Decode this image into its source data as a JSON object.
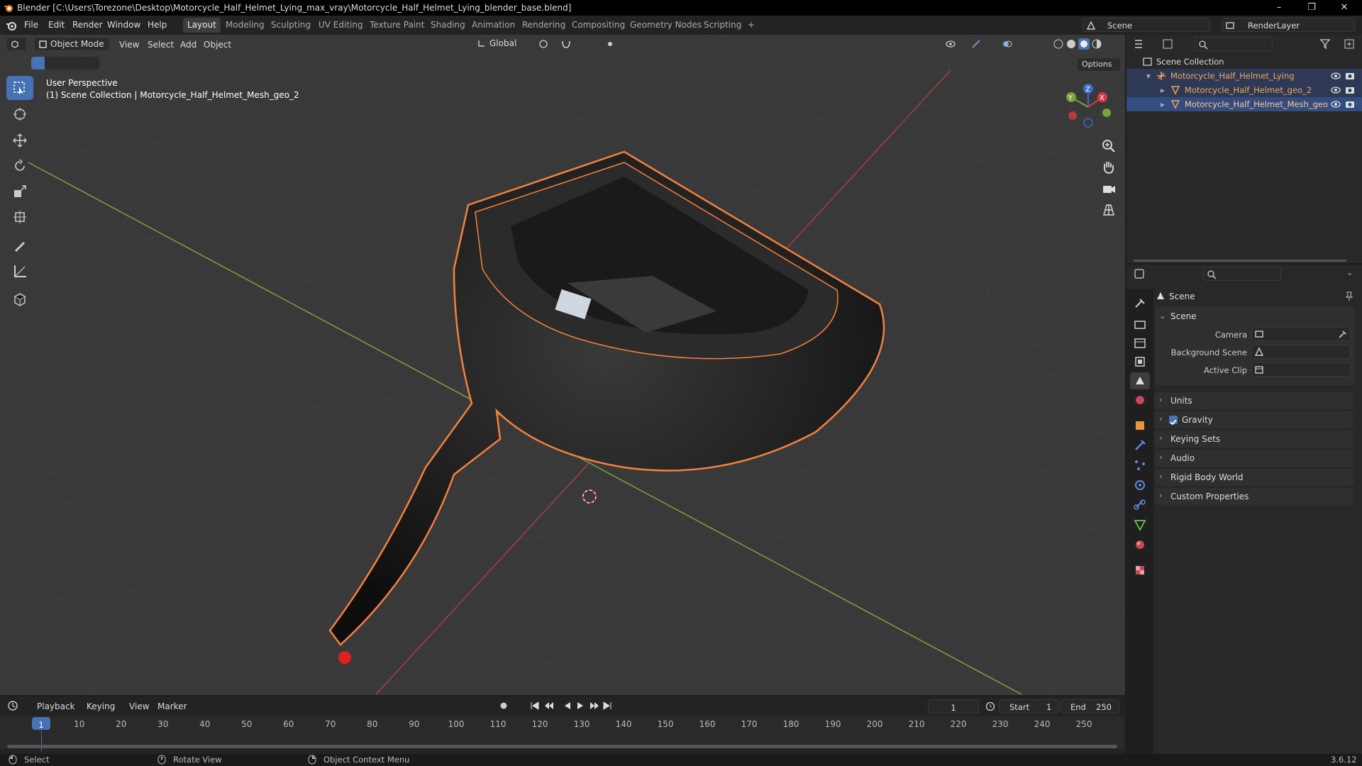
{
  "titlebar": {
    "title": "Blender [C:\\Users\\Torezone\\Desktop\\Motorcycle_Half_Helmet_Lying_max_vray\\Motorcycle_Half_Helmet_Lying_blender_base.blend]",
    "minimize": "–",
    "maximize": "❐",
    "close": "✕"
  },
  "menubar": {
    "items": [
      "File",
      "Edit",
      "Render",
      "Window",
      "Help"
    ],
    "workspaces": [
      "Layout",
      "Modeling",
      "Sculpting",
      "UV Editing",
      "Texture Paint",
      "Shading",
      "Animation",
      "Rendering",
      "Compositing",
      "Geometry Nodes",
      "Scripting"
    ],
    "add_tab": "+",
    "scene": "Scene",
    "view_layer": "RenderLayer"
  },
  "viewport": {
    "mode": "Object Mode",
    "menus": [
      "View",
      "Select",
      "Add",
      "Object"
    ],
    "transform": "Global",
    "options": "Options",
    "overlay_line1": "User Perspective",
    "overlay_line2": "(1) Scene Collection | Motorcycle_Half_Helmet_Mesh_geo_2",
    "gizmo_axes": [
      "Z",
      "Y",
      "X"
    ]
  },
  "outliner": {
    "root": "Scene Collection",
    "items": [
      {
        "name": "Motorcycle_Half_Helmet_Lying"
      },
      {
        "name": "Motorcycle_Half_Helmet_geo_2"
      },
      {
        "name": "Motorcycle_Half_Helmet_Mesh_geo"
      }
    ]
  },
  "properties": {
    "header": "Scene",
    "section": "Scene",
    "fields": [
      {
        "label": "Camera"
      },
      {
        "label": "Background Scene"
      },
      {
        "label": "Active Clip"
      }
    ],
    "sections": [
      "Units",
      "Gravity",
      "Keying Sets",
      "Audio",
      "Rigid Body World",
      "Custom Properties"
    ],
    "gravity_checked": true
  },
  "timeline": {
    "menus": [
      "Playback",
      "Keying",
      "View",
      "Marker"
    ],
    "current_frame": "1",
    "start_label": "Start",
    "start": "1",
    "end_label": "End",
    "end": "250",
    "ticks": [
      "1",
      "10",
      "20",
      "30",
      "40",
      "50",
      "60",
      "70",
      "80",
      "90",
      "100",
      "110",
      "120",
      "130",
      "140",
      "150",
      "160",
      "170",
      "180",
      "190",
      "200",
      "210",
      "220",
      "230",
      "240",
      "250"
    ]
  },
  "statusbar": {
    "select": "Select",
    "rotate": "Rotate View",
    "context": "Object Context Menu",
    "version": "3.6.12"
  },
  "colors": {
    "accent": "#4772b3",
    "selection": "#f5803e",
    "grid": "#444444",
    "x_axis": "#ad3a44",
    "y_axis": "#7aa33e"
  }
}
